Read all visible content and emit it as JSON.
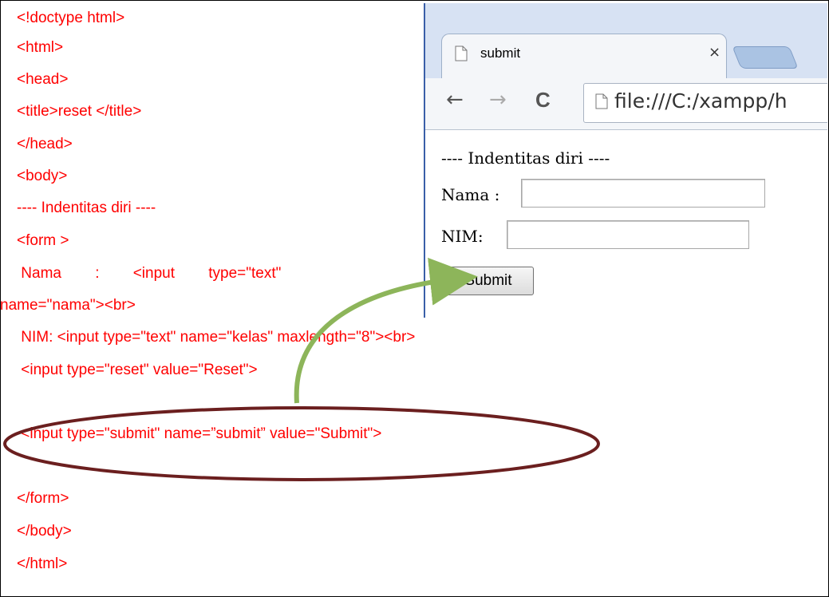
{
  "code_lines": [
    "<!doctype html>",
    "<html>",
    "<head>",
    "<title>reset </title>",
    "</head>",
    "<body>",
    "---- Indentitas diri ----",
    "<form >",
    " Nama        :        <input        type=\"text\"",
    "name=\"nama\"><br>",
    " NIM: <input type=\"text\" name=\"kelas\" maxlength=\"8\"><br>",
    " <input type=\"reset\" value=\"Reset\">",
    "",
    " <input type=\"submit\" name=”submit” value=\"Submit\">",
    "",
    "</form>",
    "</body>",
    "</html>"
  ],
  "browser": {
    "tab_title": "submit",
    "tab_close": "×",
    "back": "←",
    "forward": "→",
    "reload": "C",
    "url": "file:///C:/xampp/h",
    "page_heading": "---- Indentitas diri ----",
    "nama_label": "Nama :",
    "nim_label": "NIM:",
    "submit_label": "Submit"
  },
  "colors": {
    "code_text": "#ff0000",
    "ellipse": "#6b1f1f",
    "arrow": "#8db55a"
  }
}
